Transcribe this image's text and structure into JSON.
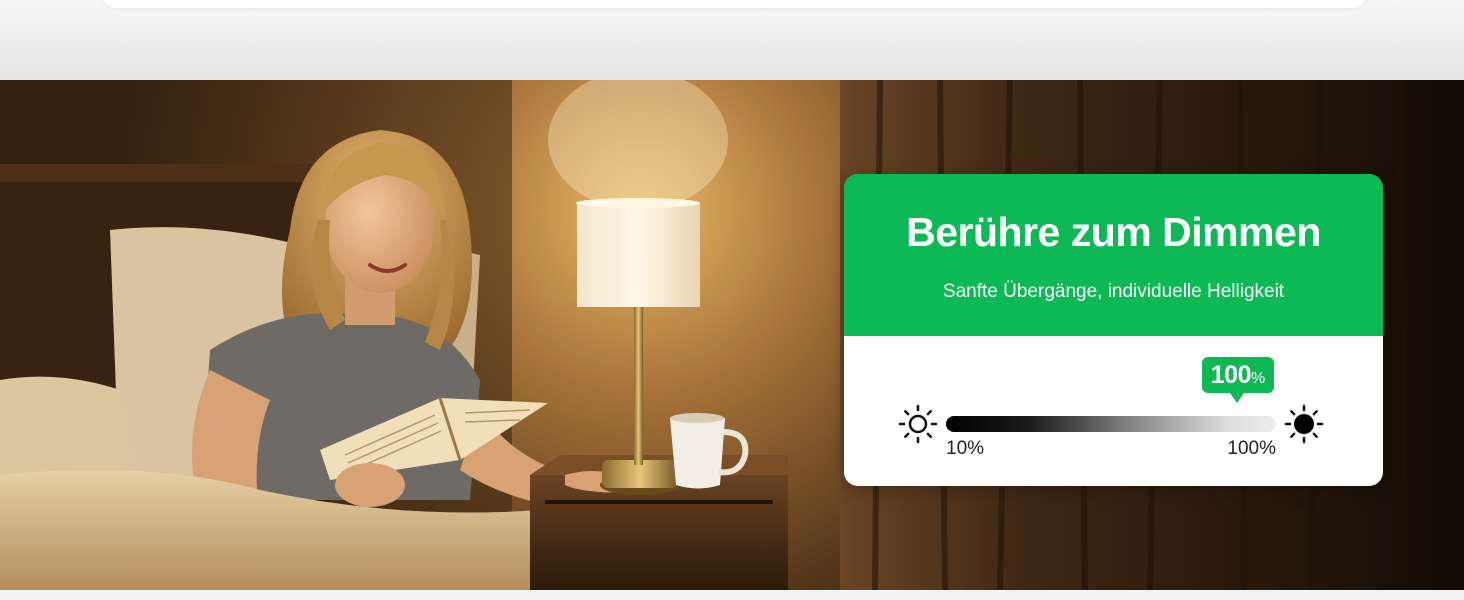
{
  "card": {
    "title": "Berühre zum Dimmen",
    "subtitle": "Sanfte Übergänge, individuelle Helligkeit",
    "accent_color": "#0cb955"
  },
  "slider": {
    "min_label": "10%",
    "max_label": "100%",
    "current_value": "100",
    "current_unit": "%",
    "current_fraction": 1.0,
    "min_icon": "sun-outline-icon",
    "max_icon": "sun-filled-icon"
  },
  "hero": {
    "scene": "woman-reading-in-bed-with-table-lamp"
  }
}
